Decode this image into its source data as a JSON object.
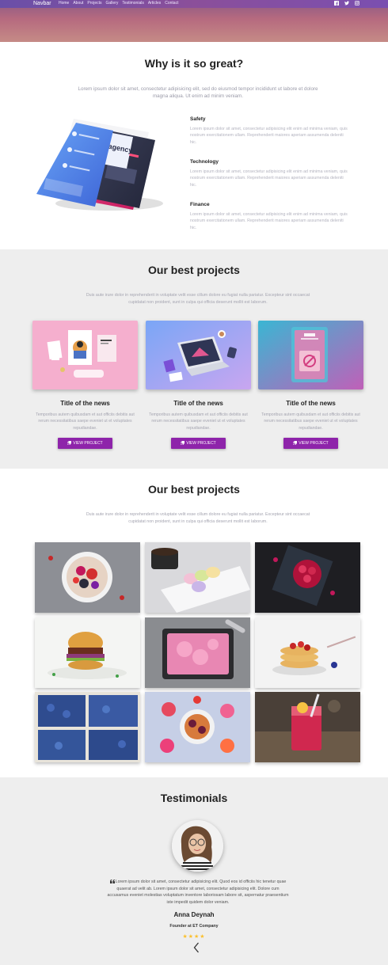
{
  "nav": {
    "brand": "Navbar",
    "links": [
      "Home",
      "About",
      "Projects",
      "Gallery",
      "Testimonials",
      "Articles",
      "Contact"
    ],
    "social_icons": [
      "facebook-icon",
      "twitter-icon",
      "instagram-icon"
    ]
  },
  "features": {
    "title": "Why is it so great?",
    "lead": "Lorem ipsum dolor sit amet, consectetur adipisicing elit, sed do eiusmod tempor incididunt ut labore et dolore magna aliqua. Ut enim ad minim veniam.",
    "items": [
      {
        "title": "Safety",
        "text": "Lorem ipsum dolor sit amet, consectetur adipisicing elit enim ad minima veniam, quis nostrum exercitationem ullam. Reprehenderit maiores aperiam assumenda deleniti hic."
      },
      {
        "title": "Technology",
        "text": "Lorem ipsum dolor sit amet, consectetur adipisicing elit enim ad minima veniam, quis nostrum exercitationem ullam. Reprehenderit maiores aperiam assumenda deleniti hic."
      },
      {
        "title": "Finance",
        "text": "Lorem ipsum dolor sit amet, consectetur adipisicing elit enim ad minima veniam, quis nostrum exercitationem ullam. Reprehenderit maiores aperiam assumenda deleniti hic."
      }
    ]
  },
  "projects": {
    "title": "Our best projects",
    "lead": "Duis aute irure dolor in reprehenderit in voluptate velit esse cillum dolore eu fugiat nulla pariatur. Excepteur sint occaecat cupidatat non proident, sunt in culpa qui officia deserunt mollit est laborum.",
    "cards": [
      {
        "title": "Title of the news",
        "text": "Temporibus autem quibusdam et aut officiis debitis aut rerum necessitatibus saepe eveniet ut et voluptates repudiandae.",
        "button": "VIEW PROJECT"
      },
      {
        "title": "Title of the news",
        "text": "Temporibus autem quibusdam et aut officiis debitis aut rerum necessitatibus saepe eveniet ut et voluptates repudiandae.",
        "button": "VIEW PROJECT"
      },
      {
        "title": "Title of the news",
        "text": "Temporibus autem quibusdam et aut officiis debitis aut rerum necessitatibus saepe eveniet ut et voluptates repudiandae.",
        "button": "VIEW PROJECT"
      }
    ]
  },
  "gallery": {
    "title": "Our best projects",
    "lead": "Duis aute irure dolor in reprehenderit in voluptate velit esse cillum dolore eu fugiat nulla pariatur. Excepteur sint occaecat cupidatat non proident, sunt in culpa qui officia deserunt mollit est laborum."
  },
  "testimonials": {
    "title": "Testimonials",
    "quote": "Lorem ipsum dolor sit amet, consectetur adipisicing elit. Quod eos id officiis hic tenetur quae quaerat ad velit ab. Lorem ipsum dolor sit amet, consectetur adipisicing elit. Dolore cum accusamus eveniet molestias voluptatum inventore laboriosam labore sit, aspernatur praesentium iste impedit quidem dolor veniam.",
    "name": "Anna Deynah",
    "role": "Founder at ET Company",
    "rating": 4,
    "stars": "★★★★"
  },
  "colors": {
    "accent": "#8e24aa",
    "nav": "#7a4fb0",
    "star": "#fbc02d"
  }
}
